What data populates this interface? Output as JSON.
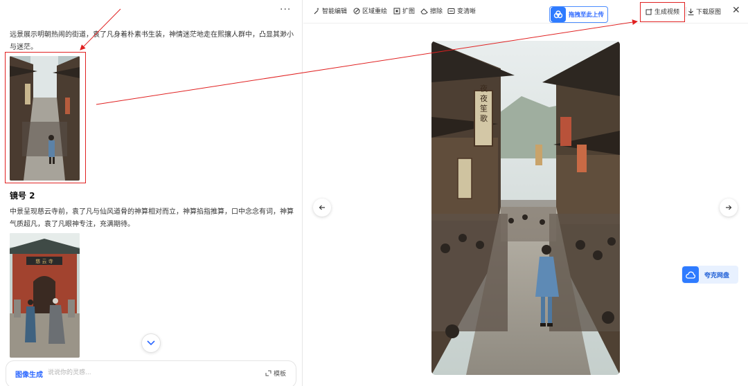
{
  "left_panel": {
    "more_label": "···",
    "paragraph_1": "远景展示明朝热闹的街道，袁了凡身着朴素书生装，神情迷茫地走在熙攘人群中，凸显其渺小与迷茫。",
    "shot_2_title": "镜号 2",
    "paragraph_2": "中景呈现慈云寺前，袁了凡与仙风道骨的神算相对而立，神算掐指推算，口中念念有词，神算气质超凡，袁了凡眼神专注，充满期待。",
    "temple_plaque": "慈 云 寺",
    "input_bar": {
      "mode_label": "图像生成",
      "placeholder": "说说你的灵感...",
      "template_label": "模板"
    }
  },
  "toolbar": {
    "tools": [
      {
        "label": "智能编辑",
        "icon": "magic-wand-icon"
      },
      {
        "label": "区域重绘",
        "icon": "brush-icon"
      },
      {
        "label": "扩图",
        "icon": "expand-icon"
      },
      {
        "label": "擦除",
        "icon": "eraser-icon"
      },
      {
        "label": "变清晰",
        "icon": "hd-icon"
      }
    ],
    "upload_label": "拖拽至此上传",
    "generate_video_label": "生成视频",
    "download_label": "下载原图",
    "close_label": "✕"
  },
  "main_image": {
    "banners": [
      "夜 夜 笙 歌"
    ]
  },
  "quark_label": "夸克网盘",
  "colors": {
    "accent": "#2a66ff",
    "annotation_red": "#e02020"
  }
}
